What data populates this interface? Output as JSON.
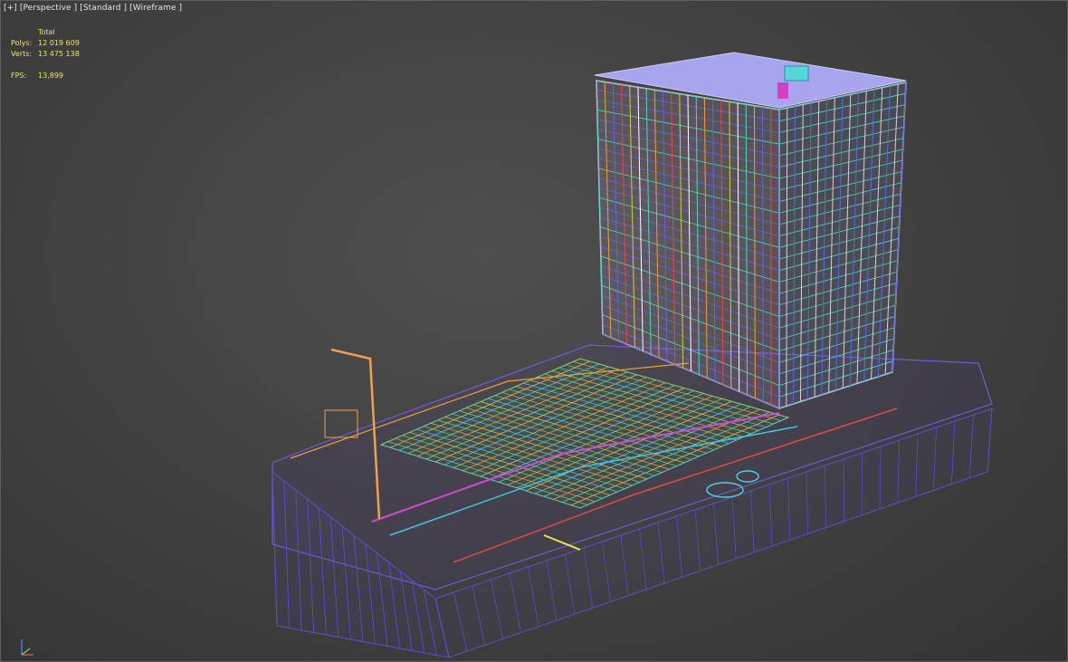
{
  "viewport": {
    "menu": {
      "plus": "[+]",
      "view": "[Perspective ]",
      "shading": "[Standard ]",
      "mode": "[Wireframe ]"
    },
    "stats": {
      "header": "Total",
      "polys_label": "Polys:",
      "polys_value": "12 019 609",
      "verts_label": "Verts:",
      "verts_value": "13 475 138",
      "fps_label": "FPS:",
      "fps_value": "13,899"
    },
    "axis": {
      "x": "x",
      "y": "y",
      "z": "z"
    }
  },
  "colors": {
    "background": "#404040",
    "stats_text": "#e8e26a",
    "menu_text": "#e6e6e6",
    "podium_wire": "#6a5acd",
    "tower_wire": "#4fd6c8",
    "roof": "#a9a6ef",
    "streetlight": "#f0a050"
  }
}
